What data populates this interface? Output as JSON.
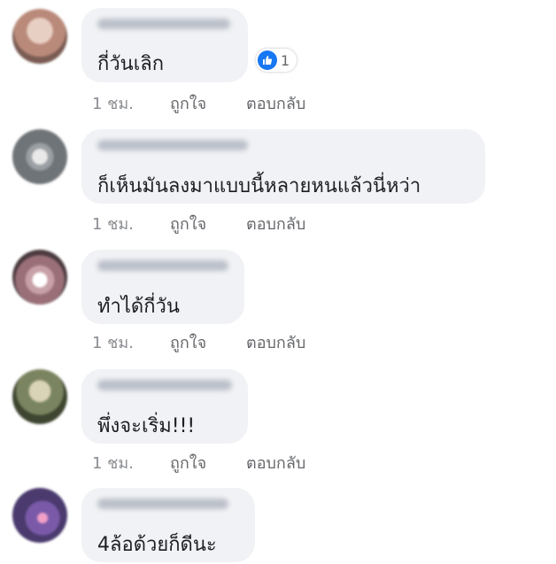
{
  "comments": [
    {
      "text": "กี่วันเลิก",
      "time": "1 ชม.",
      "like": "ถูกใจ",
      "reply": "ตอบกลับ",
      "reaction_count": "1",
      "avatar_color": "#b98a7a"
    },
    {
      "text": "ก็เห็นมันลงมาแบบนี้หลายหนแล้วนี่หว่า",
      "time": "1 ชม.",
      "like": "ถูกใจ",
      "reply": "ตอบกลับ",
      "avatar_color": "#6f7478"
    },
    {
      "text": "ทำได้กี่วัน",
      "time": "1 ชม.",
      "like": "ถูกใจ",
      "reply": "ตอบกลับ",
      "avatar_color": "#9a6f78"
    },
    {
      "text": "พึ่งจะเริ่ม!!!",
      "time": "1 ชม.",
      "like": "ถูกใจ",
      "reply": "ตอบกลับ",
      "avatar_color": "#7b8460"
    },
    {
      "text": "4ล้อด้วยก็ดีนะ",
      "time": "",
      "like": "",
      "reply": "",
      "avatar_color": "#4a3a6e"
    }
  ]
}
